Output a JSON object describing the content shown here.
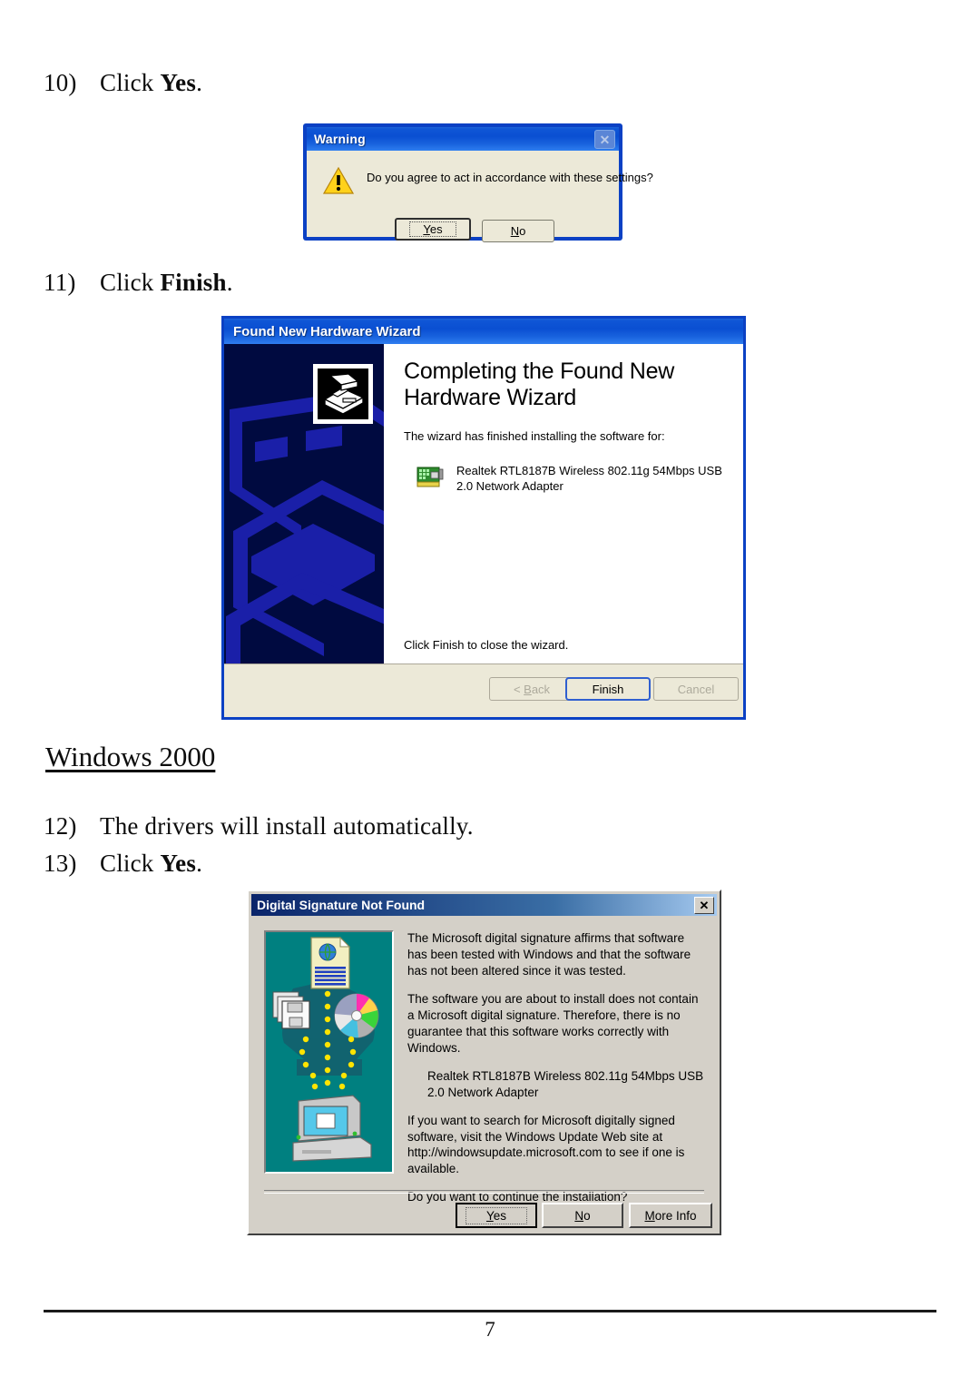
{
  "document": {
    "steps": [
      {
        "num": "10)",
        "text_before": "Click ",
        "bold": "Yes",
        "text_after": "."
      },
      {
        "num": "11)",
        "text_before": "Click ",
        "bold": "Finish",
        "text_after": "."
      },
      {
        "num": "12)",
        "text_before": "The drivers will install automatically.",
        "bold": "",
        "text_after": ""
      },
      {
        "num": "13)",
        "text_before": "Click ",
        "bold": "Yes",
        "text_after": "."
      }
    ],
    "section_heading": "Windows 2000",
    "page_number": "7"
  },
  "warning_dialog": {
    "title": "Warning",
    "message": "Do you agree to act in accordance with these settings?",
    "close_label": "✕",
    "buttons": {
      "yes_prefix": "",
      "yes_accel": "Y",
      "yes_rest": "es",
      "no_accel": "N",
      "no_rest": "o"
    },
    "colors": {
      "titlebar_blue": "#0a4fd2",
      "face": "#ece9d8",
      "border": "#0b41c4",
      "warning_yellow": "#ffd11a"
    }
  },
  "wizard_dialog": {
    "title": "Found New Hardware Wizard",
    "heading_line1": "Completing the Found New",
    "heading_line2": "Hardware Wizard",
    "intro": "The wizard has finished installing the software for:",
    "device_line1": "Realtek RTL8187B Wireless 802.11g 54Mbps USB",
    "device_line2": "2.0 Network Adapter",
    "finish_note": "Click Finish to close the wizard.",
    "buttons": {
      "back_prefix": "< ",
      "back_accel": "B",
      "back_rest": "ack",
      "finish": "Finish",
      "cancel": "Cancel"
    },
    "colors": {
      "panel_navy": "#000a40",
      "watermark_blue": "#1a1fa8",
      "titlebar_blue": "#0a4fd2"
    }
  },
  "signature_dialog": {
    "title": "Digital Signature Not Found",
    "close_label": "✕",
    "paragraphs": [
      "The Microsoft digital signature affirms that software has been tested with Windows and that the software has not been altered since it was tested.",
      "The software you are about to install does not contain a Microsoft digital signature. Therefore,  there is no guarantee that this software works correctly with Windows."
    ],
    "device_line1": "Realtek RTL8187B Wireless 802.11g 54Mbps USB",
    "device_line2": "2.0 Network Adapter",
    "paragraph3": "If you want to search for Microsoft digitally signed software, visit the Windows Update Web site at http://windowsupdate.microsoft.com to see if one is available.",
    "question": "Do you want to continue the installation?",
    "buttons": {
      "yes_accel": "Y",
      "yes_rest": "es",
      "no_accel": "N",
      "no_rest": "o",
      "more_accel": "M",
      "more_rest": "ore Info"
    },
    "colors": {
      "titlebar_navy": "#0a246a",
      "face": "#d4d0c8",
      "art_teal": "#008080"
    }
  }
}
